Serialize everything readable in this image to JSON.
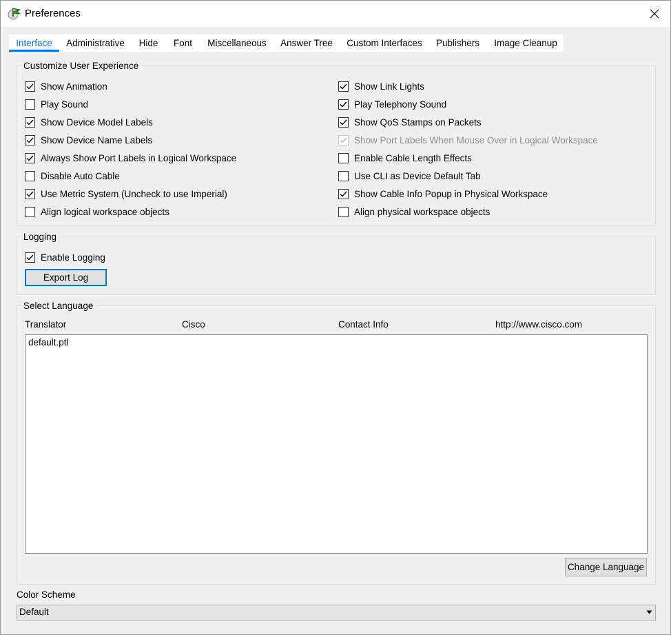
{
  "window": {
    "title": "Preferences"
  },
  "tabs": [
    {
      "label": "Interface",
      "active": true
    },
    {
      "label": "Administrative"
    },
    {
      "label": "Hide"
    },
    {
      "label": "Font"
    },
    {
      "label": "Miscellaneous"
    },
    {
      "label": "Answer Tree"
    },
    {
      "label": "Custom Interfaces"
    },
    {
      "label": "Publishers"
    },
    {
      "label": "Image Cleanup"
    }
  ],
  "customize": {
    "title": "Customize User Experience",
    "left": [
      {
        "label": "Show Animation",
        "checked": true
      },
      {
        "label": "Play Sound",
        "checked": false
      },
      {
        "label": "Show Device Model Labels",
        "checked": true
      },
      {
        "label": "Show Device Name Labels",
        "checked": true
      },
      {
        "label": "Always Show Port Labels in Logical Workspace",
        "checked": true
      },
      {
        "label": "Disable Auto Cable",
        "checked": false
      },
      {
        "label": "Use Metric System (Uncheck to use Imperial)",
        "checked": true
      },
      {
        "label": "Align logical workspace objects",
        "checked": false
      }
    ],
    "right": [
      {
        "label": "Show Link Lights",
        "checked": true
      },
      {
        "label": "Play Telephony Sound",
        "checked": true
      },
      {
        "label": "Show QoS Stamps on Packets",
        "checked": true
      },
      {
        "label": "Show Port Labels When Mouse Over in Logical Workspace",
        "checked": true,
        "disabled": true
      },
      {
        "label": "Enable Cable Length Effects",
        "checked": false
      },
      {
        "label": "Use CLI as Device Default Tab",
        "checked": false
      },
      {
        "label": "Show Cable Info Popup in Physical Workspace",
        "checked": true
      },
      {
        "label": "Align physical workspace objects",
        "checked": false
      }
    ]
  },
  "logging": {
    "title": "Logging",
    "enable_label": "Enable Logging",
    "enable_checked": true,
    "export_label": "Export Log"
  },
  "language": {
    "title": "Select Language",
    "translator_label": "Translator",
    "translator_value": "Cisco",
    "contact_label": "Contact Info",
    "contact_value": "http://www.cisco.com",
    "items": [
      "default.ptl"
    ],
    "change_label": "Change Language"
  },
  "color_scheme": {
    "label": "Color Scheme",
    "value": "Default"
  },
  "colors": {
    "accent": "#0078d7",
    "background": "#f0f0f0",
    "disabled_text": "#8d8d8d"
  }
}
